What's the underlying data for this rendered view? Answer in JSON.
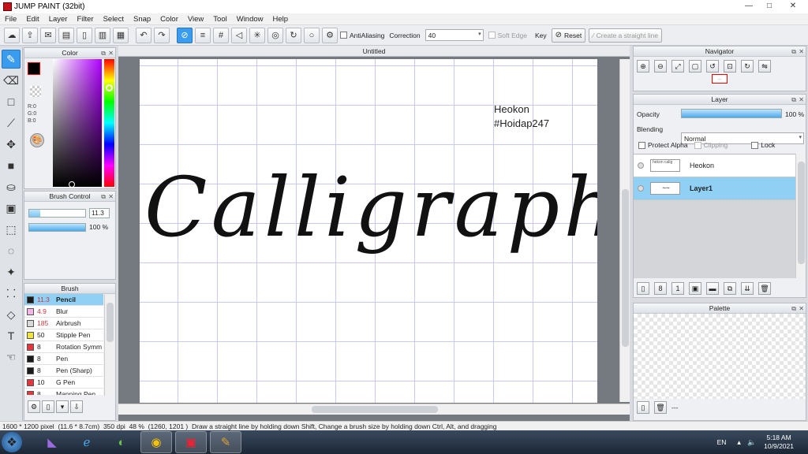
{
  "app": {
    "title": "JUMP PAINT (32bit)"
  },
  "window_controls": {
    "minimize": "—",
    "maximize": "□",
    "close": "✕"
  },
  "menu": [
    "File",
    "Edit",
    "Layer",
    "Filter",
    "Select",
    "Snap",
    "Color",
    "View",
    "Tool",
    "Window",
    "Help"
  ],
  "toolbar": {
    "antialiasing_label": "AntiAliasing",
    "correction_label": "Correction",
    "correction_value": "40",
    "soft_edge_label": "Soft Edge",
    "key_label": "Key",
    "reset_label": "Reset",
    "straight_line_label": "Create a straight line"
  },
  "color_panel": {
    "title": "Color",
    "rgb": [
      "R:0",
      "G:0",
      "B:0"
    ],
    "primary_color": "#000000",
    "secondary_color": "#ffffff"
  },
  "brush_control": {
    "title": "Brush Control",
    "size_value": "11.3",
    "opacity_value": "100 %"
  },
  "brush_panel": {
    "title": "Brush",
    "items": [
      {
        "size": "11.3",
        "name": "Pencil",
        "color": "#1a1a1a",
        "size_color": "#d0363a"
      },
      {
        "size": "4.9",
        "name": "Blur",
        "color": "#f4b6e6",
        "size_color": "#d0363a"
      },
      {
        "size": "185",
        "name": "Airbrush",
        "color": "#d9d9d9",
        "size_color": "#d0363a"
      },
      {
        "size": "50",
        "name": "Stipple Pen",
        "color": "#f0e33a",
        "size_color": "#222222"
      },
      {
        "size": "8",
        "name": "Rotation Symm",
        "color": "#e8343a",
        "size_color": "#222222"
      },
      {
        "size": "8",
        "name": "Pen",
        "color": "#1a1a1a",
        "size_color": "#222222"
      },
      {
        "size": "8",
        "name": "Pen (Sharp)",
        "color": "#1a1a1a",
        "size_color": "#222222"
      },
      {
        "size": "10",
        "name": "G Pen",
        "color": "#e8343a",
        "size_color": "#222222"
      },
      {
        "size": "8",
        "name": "Mapping Pen",
        "color": "#e8343a",
        "size_color": "#222222"
      }
    ]
  },
  "document": {
    "tab": "Untitled",
    "text_heokon": "Heokon",
    "text_hashtag": "#Hoidap247",
    "calligraphy": "Calligraphy"
  },
  "navigator": {
    "title": "Navigator"
  },
  "layer_panel": {
    "title": "Layer",
    "opacity_label": "Opacity",
    "opacity_value": "100 %",
    "blending_label": "Blending",
    "blending_value": "Normal",
    "protect_alpha": "Protect Alpha",
    "clipping": "Clipping",
    "lock": "Lock",
    "layers": [
      {
        "name": "Heokon",
        "thumb": "hekon calig",
        "selected": false
      },
      {
        "name": "Layer1",
        "thumb": "~~",
        "selected": true
      }
    ]
  },
  "palette_panel": {
    "title": "Palette",
    "footer_text": "---"
  },
  "statusbar": {
    "size": "1600 * 1200 pixel",
    "cm": "(11.6 * 8.7cm)",
    "dpi": "350 dpi",
    "zoom": "48 %",
    "coords": "(1260, 1201 )",
    "hint": "Draw a straight line by holding down Shift, Change a brush size by holding down Ctrl, Alt, and dragging"
  },
  "taskbar": {
    "lang": "EN",
    "time": "5:18 AM",
    "date": "10/9/2021"
  }
}
